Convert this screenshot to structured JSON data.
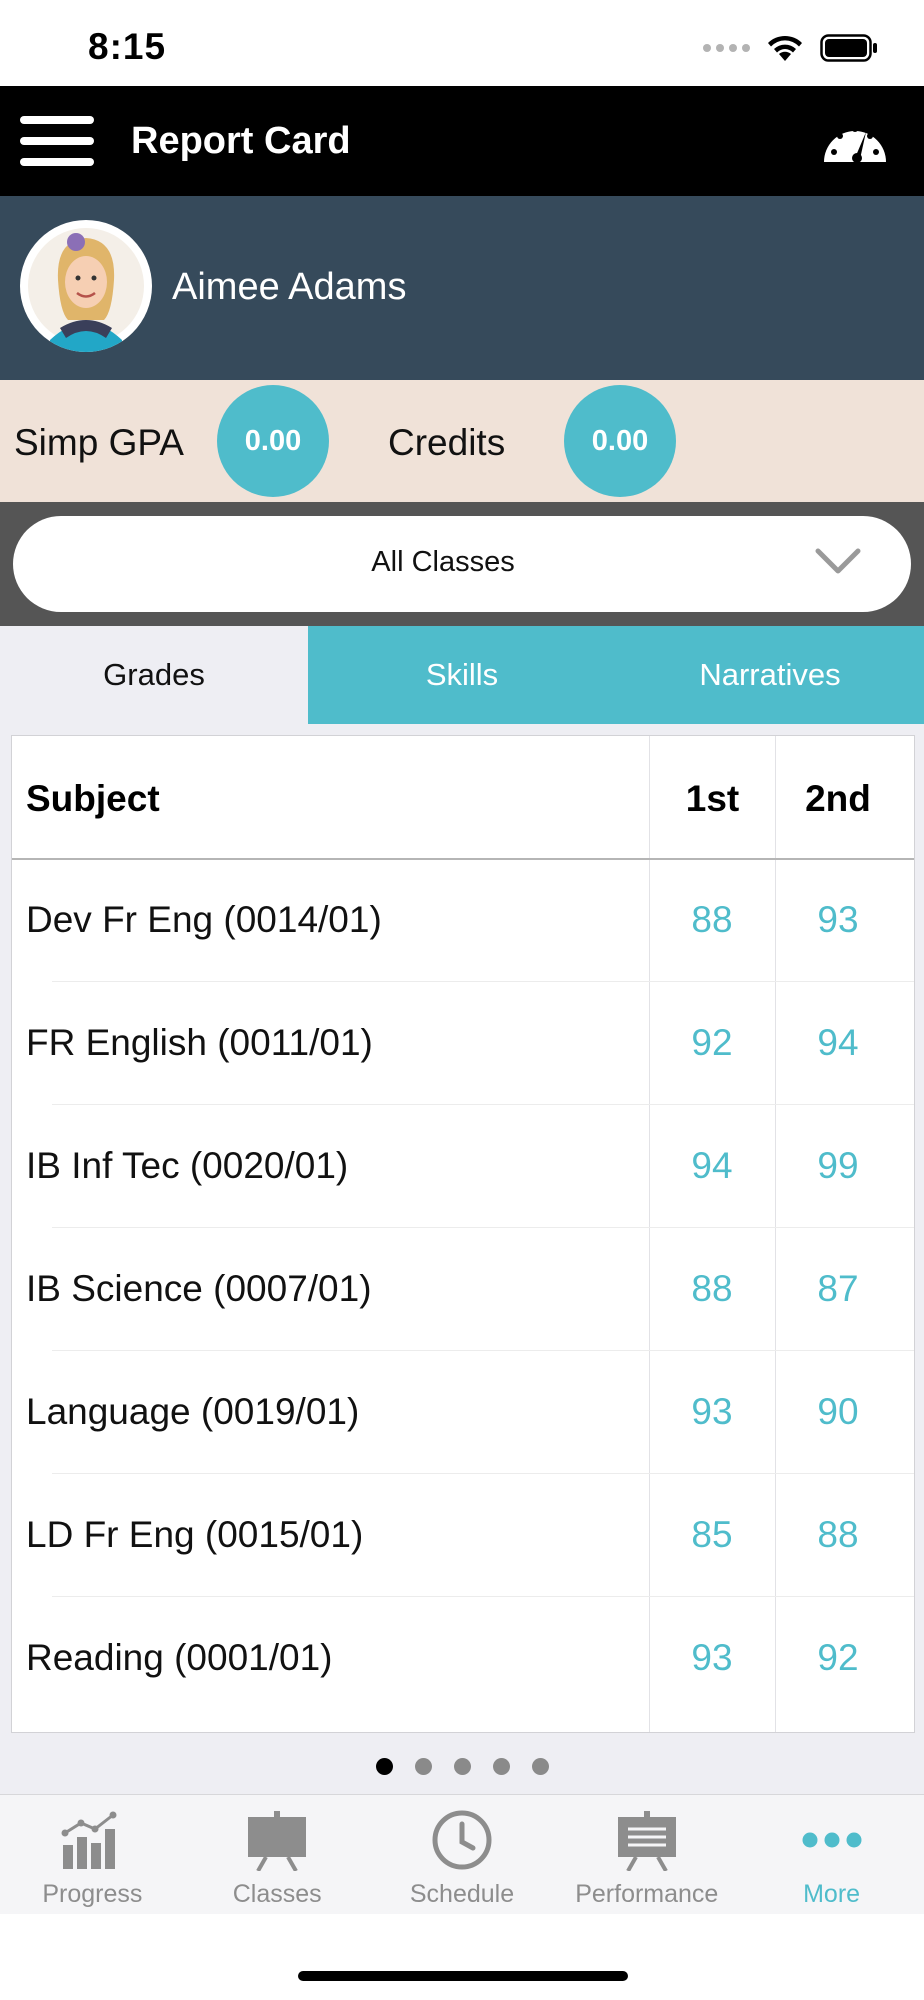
{
  "status_bar": {
    "time": "8:15"
  },
  "header": {
    "title": "Report Card"
  },
  "student": {
    "name": "Aimee Adams"
  },
  "stats": {
    "gpa_label": "Simp GPA",
    "gpa_value": "0.00",
    "credits_label": "Credits",
    "credits_value": "0.00"
  },
  "filter": {
    "selected": "All Classes"
  },
  "tabs": [
    {
      "label": "Grades",
      "active": true
    },
    {
      "label": "Skills",
      "active": false
    },
    {
      "label": "Narratives",
      "active": false
    }
  ],
  "grades_table": {
    "columns": [
      "Subject",
      "1st",
      "2nd"
    ],
    "rows": [
      {
        "subject": "Dev Fr Eng (0014/01)",
        "first": "88",
        "second": "93"
      },
      {
        "subject": "FR English (0011/01)",
        "first": "92",
        "second": "94"
      },
      {
        "subject": "IB Inf Tec (0020/01)",
        "first": "94",
        "second": "99"
      },
      {
        "subject": "IB Science (0007/01)",
        "first": "88",
        "second": "87"
      },
      {
        "subject": "Language (0019/01)",
        "first": "93",
        "second": "90"
      },
      {
        "subject": "LD Fr Eng (0015/01)",
        "first": "85",
        "second": "88"
      },
      {
        "subject": "Reading (0001/01)",
        "first": "93",
        "second": "92"
      }
    ]
  },
  "pager": {
    "total": 5,
    "current": 1
  },
  "tab_bar": [
    {
      "label": "Progress",
      "icon": "bar-chart-icon",
      "active": false
    },
    {
      "label": "Classes",
      "icon": "easel-icon",
      "active": false
    },
    {
      "label": "Schedule",
      "icon": "clock-icon",
      "active": false
    },
    {
      "label": "Performance",
      "icon": "presentation-board-icon",
      "active": false
    },
    {
      "label": "More",
      "icon": "more-dots-icon",
      "active": true
    }
  ],
  "colors": {
    "accent": "#4fbccb",
    "navbar": "#000000",
    "profile_bg": "#364a5b",
    "stats_bg": "#f0e2d8",
    "filter_bg": "#555555"
  }
}
